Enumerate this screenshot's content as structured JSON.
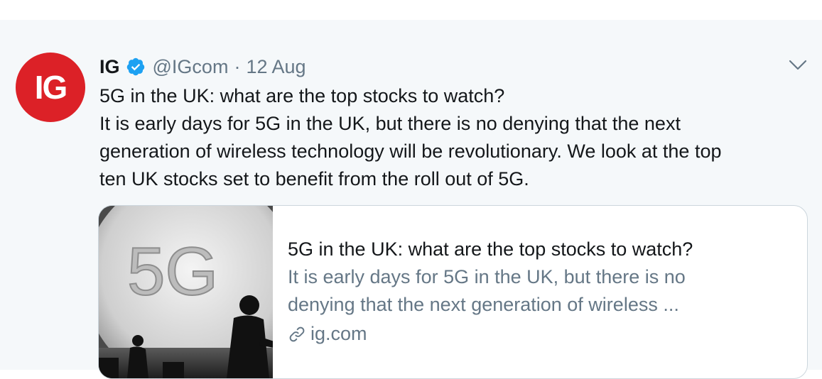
{
  "tweet": {
    "avatar_text": "IG",
    "name": "IG",
    "handle": "@IGcom",
    "separator": "·",
    "date": "12 Aug",
    "text_lines": [
      "5G in the UK: what are the top stocks to watch?",
      "It is early days for 5G in the UK, but there is no denying that the next",
      "generation of wireless technology will be revolutionary. We look at the top",
      "ten UK stocks set to benefit from the roll out of 5G."
    ]
  },
  "card": {
    "image_text": "5G",
    "title": "5G in the UK: what are the top stocks to watch?",
    "description_lines": [
      "It is early days for 5G in the UK, but there is no",
      "denying that the next generation of wireless ..."
    ],
    "domain": "ig.com"
  },
  "colors": {
    "brand_red": "#dc2127",
    "verified_blue": "#1da1f2",
    "secondary_text": "#657786",
    "background": "#f5f8fa"
  },
  "icons": {
    "verified": "verified-badge-icon",
    "caret": "chevron-down-icon",
    "link": "link-icon"
  }
}
